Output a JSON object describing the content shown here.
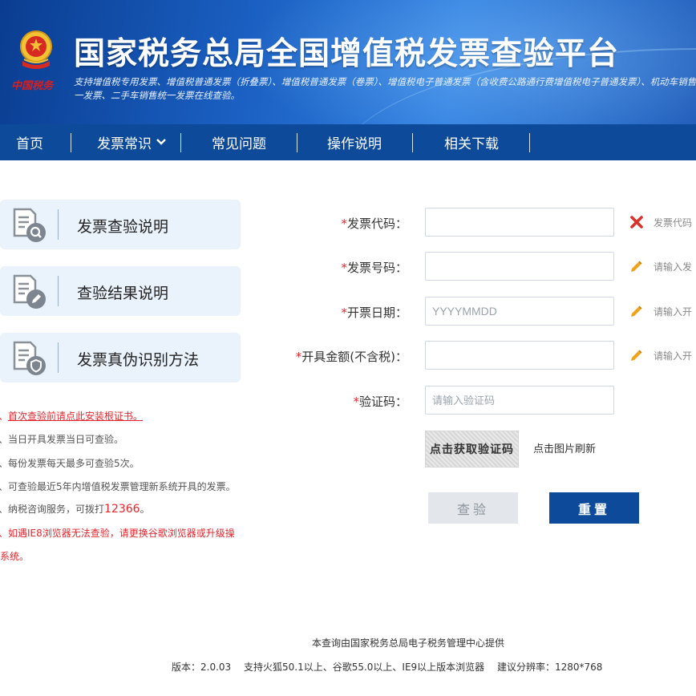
{
  "header": {
    "logo_text": "中国税务",
    "title": "国家税务总局全国增值税发票查验平台",
    "subtitle": "支持增值税专用发票、增值税普通发票（折叠票）、增值税普通发票（卷票）、增值税电子普通发票（含收费公路通行费增值税电子普通发票）、机动车销售统一发票、二手车销售统一发票在线查验。"
  },
  "nav": {
    "items": [
      {
        "label": "首页"
      },
      {
        "label": "发票常识"
      },
      {
        "label": "常见问题"
      },
      {
        "label": "操作说明"
      },
      {
        "label": "相关下载"
      }
    ]
  },
  "sidebar": {
    "cards": [
      {
        "label": "发票查验说明",
        "icon": "magnifier-document-icon"
      },
      {
        "label": "查验结果说明",
        "icon": "pencil-document-icon"
      },
      {
        "label": "发票真伪识别方法",
        "icon": "shield-document-icon"
      }
    ],
    "notes": {
      "n1": "首次查验前请点此安装根证书。",
      "n2": "当日开具发票当日可查验。",
      "n3": "每份发票每天最多可查验5次。",
      "n4": "可查验最近5年内增值税发票管理新系统开具的发票。",
      "n5_prefix": "纳税咨询服务，可拨打",
      "n5_number": "12366",
      "n5_suffix": "。",
      "n6a": "如遇IE8浏览器无法查验，请更换谷歌浏览器或升级操",
      "n6b": "作系统。"
    }
  },
  "form": {
    "star": "*",
    "code_label": "发票代码：",
    "code_value": "",
    "code_hint": "发票代码",
    "number_label": "发票号码：",
    "number_value": "",
    "number_hint": "请输入发",
    "date_label": "开票日期：",
    "date_placeholder": "YYYYMMDD",
    "date_hint": "请输入开",
    "amount_label": "开具金额(不含税)：",
    "amount_value": "",
    "amount_hint": "请输入开",
    "captcha_label": "验证码：",
    "captcha_placeholder": "请输入验证码",
    "captcha_image_text": "点击获取验证码",
    "captcha_tip": "点击图片刷新",
    "query_button": "查验",
    "reset_button": "重置"
  },
  "footer": {
    "provider": "本查询由国家税务总局电子税务管理中心提供",
    "version_info": "版本：2.0.03　 支持火狐50.1以上、谷歌55.0以上、IE9以上版本浏览器　 建议分辨率：1280*768"
  },
  "colors": {
    "nav_bg": "#0d4b9a",
    "accent_red": "#e5262c",
    "card_bg": "#eaf2fb"
  }
}
